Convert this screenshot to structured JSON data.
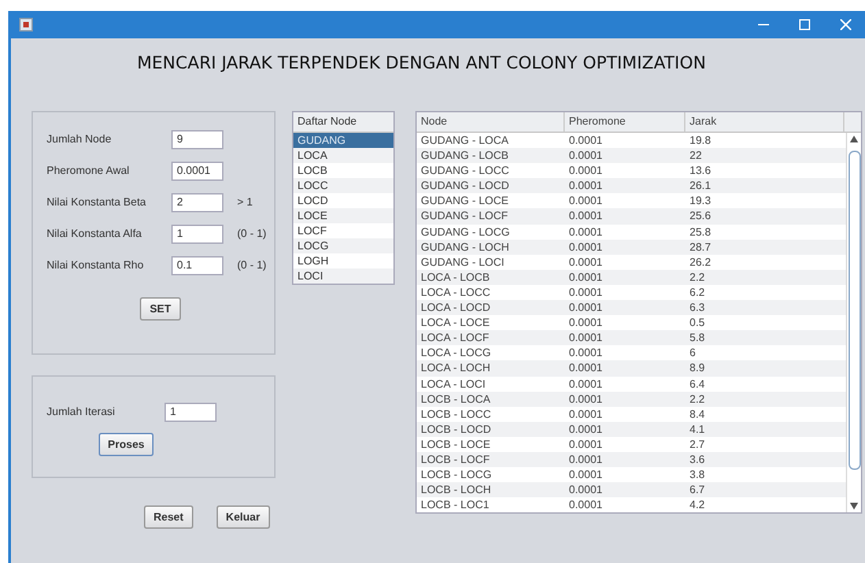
{
  "window": {
    "title": "MENCARI JARAK TERPENDEK DENGAN ANT COLONY OPTIMIZATION"
  },
  "parameters": [
    {
      "label": "Jumlah Node",
      "value": "9"
    },
    {
      "label": "Pheromone Awal",
      "value": "0.0001"
    },
    {
      "label": "Nilai Konstanta Beta",
      "value": "2",
      "hint": "> 1"
    },
    {
      "label": "Nilai Konstanta Alfa",
      "value": "1",
      "hint": "(0 - 1)"
    },
    {
      "label": "Nilai Konstanta Rho",
      "value": "0.1",
      "hint": "(0 - 1)"
    }
  ],
  "set_button": "SET",
  "iteration": {
    "label": "Jumlah Iterasi",
    "value": "1"
  },
  "process_button": "Proses",
  "buttons": [
    "Reset",
    "Keluar"
  ],
  "node_list": {
    "header": "Daftar Node",
    "items": [
      {
        "label": "GUDANG",
        "selected": true
      },
      {
        "label": "LOCA",
        "selected": false
      },
      {
        "label": "LOCB",
        "selected": false
      },
      {
        "label": "LOCC",
        "selected": false
      },
      {
        "label": "LOCD",
        "selected": false
      },
      {
        "label": "LOCE",
        "selected": false
      },
      {
        "label": "LOCF",
        "selected": false
      },
      {
        "label": "LOCG",
        "selected": false
      },
      {
        "label": "LOGH",
        "selected": false
      },
      {
        "label": "LOCI",
        "selected": false
      }
    ]
  },
  "table": {
    "columns": [
      "Node",
      "Pheromone",
      "Jarak"
    ],
    "rows": [
      [
        "GUDANG - LOCA",
        "0.0001",
        "19.8"
      ],
      [
        "GUDANG - LOCB",
        "0.0001",
        "22"
      ],
      [
        "GUDANG - LOCC",
        "0.0001",
        "13.6"
      ],
      [
        "GUDANG - LOCD",
        "0.0001",
        "26.1"
      ],
      [
        "GUDANG - LOCE",
        "0.0001",
        "19.3"
      ],
      [
        "GUDANG - LOCF",
        "0.0001",
        "25.6"
      ],
      [
        "GUDANG - LOCG",
        "0.0001",
        "25.8"
      ],
      [
        "GUDANG - LOCH",
        "0.0001",
        "28.7"
      ],
      [
        "GUDANG - LOCI",
        "0.0001",
        "26.2"
      ],
      [
        "LOCA - LOCB",
        "0.0001",
        "2.2"
      ],
      [
        "LOCA - LOCC",
        "0.0001",
        "6.2"
      ],
      [
        "LOCA - LOCD",
        "0.0001",
        "6.3"
      ],
      [
        "LOCA - LOCE",
        "0.0001",
        "0.5"
      ],
      [
        "LOCA - LOCF",
        "0.0001",
        "5.8"
      ],
      [
        "LOCA - LOCG",
        "0.0001",
        "6"
      ],
      [
        "LOCA - LOCH",
        "0.0001",
        "8.9"
      ],
      [
        "LOCA - LOCI",
        "0.0001",
        "6.4"
      ],
      [
        "LOCB - LOCA",
        "0.0001",
        "2.2"
      ],
      [
        "LOCB - LOCC",
        "0.0001",
        "8.4"
      ],
      [
        "LOCB - LOCD",
        "0.0001",
        "4.1"
      ],
      [
        "LOCB - LOCE",
        "0.0001",
        "2.7"
      ],
      [
        "LOCB - LOCF",
        "0.0001",
        "3.6"
      ],
      [
        "LOCB - LOCG",
        "0.0001",
        "3.8"
      ],
      [
        "LOCB - LOCH",
        "0.0001",
        "6.7"
      ],
      [
        "LOCB - LOC1",
        "0.0001",
        "4.2"
      ]
    ]
  }
}
